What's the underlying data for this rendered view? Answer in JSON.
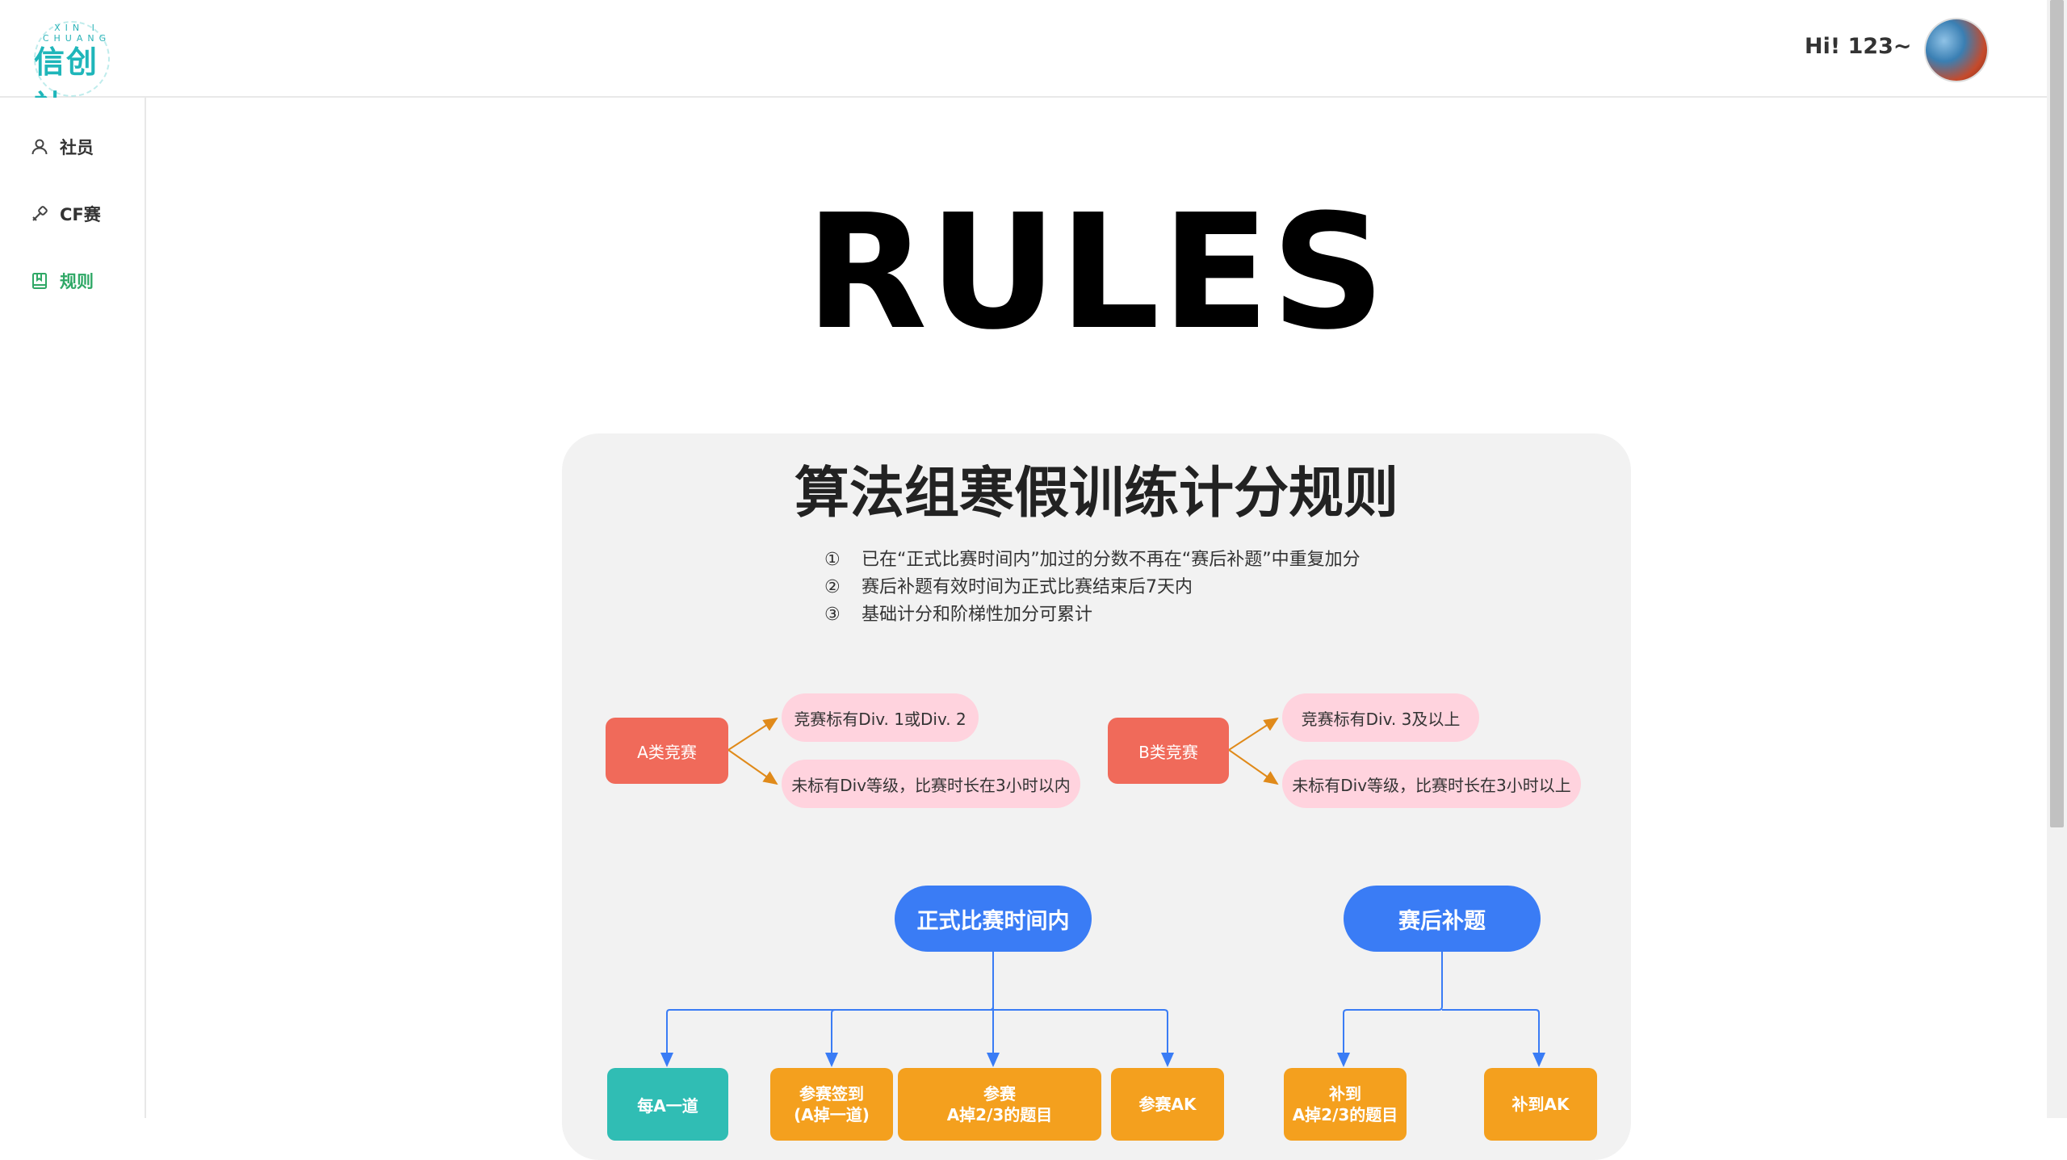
{
  "header": {
    "logo_small": "XIN I CHUANG",
    "logo_main": "信创社",
    "greeting": "Hi! 123~"
  },
  "sidebar": {
    "items": [
      {
        "label": "社员",
        "icon": "user-icon",
        "active": false
      },
      {
        "label": "CF赛",
        "icon": "wrench-icon",
        "active": false
      },
      {
        "label": "规则",
        "icon": "book-icon",
        "active": true
      }
    ]
  },
  "main": {
    "title": "RULES",
    "card": {
      "title": "算法组寒假训练计分规则",
      "notes": [
        {
          "num": "①",
          "text": "已在“正式比赛时间内”加过的分数不再在“赛后补题”中重复加分"
        },
        {
          "num": "②",
          "text": "赛后补题有效时间为正式比赛结束后7天内"
        },
        {
          "num": "③",
          "text": "基础计分和阶梯性加分可累计"
        }
      ],
      "class_a": {
        "label": "A类竞赛",
        "conditions": [
          "竞赛标有Div. 1或Div. 2",
          "未标有Div等级，比赛时长在3小时以内"
        ]
      },
      "class_b": {
        "label": "B类竞赛",
        "conditions": [
          "竞赛标有Div. 3及以上",
          "未标有Div等级，比赛时长在3小时以上"
        ]
      },
      "contest_time": {
        "label": "正式比赛时间内",
        "items": [
          {
            "line1": "每A一道",
            "line2": ""
          },
          {
            "line1": "参赛签到",
            "line2": "(A掉一道)"
          },
          {
            "line1": "参赛",
            "line2": "A掉2/3的题目"
          },
          {
            "line1": "参赛AK",
            "line2": ""
          }
        ]
      },
      "after_contest": {
        "label": "赛后补题",
        "items": [
          {
            "line1": "补到",
            "line2": "A掉2/3的题目"
          },
          {
            "line1": "补到AK",
            "line2": ""
          }
        ]
      }
    }
  },
  "colors": {
    "accent_green": "#2fa866",
    "red_box": "#f06a5a",
    "pink_box": "#ffd3de",
    "blue_box": "#3a7cf5",
    "teal_box": "#30bdb4",
    "orange_box": "#f4a01e"
  }
}
